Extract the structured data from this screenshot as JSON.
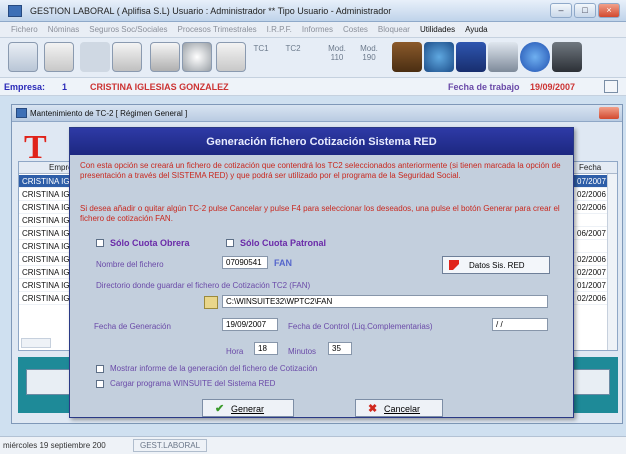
{
  "window": {
    "title": "GESTION LABORAL  ( Aplifisa S.L)  Usuario : Administrador  **  Tipo Usuario - Administrador"
  },
  "menu": [
    "Fichero",
    "Nóminas",
    "Seguros Soc/Sociales",
    "Procesos Trimestrales",
    "I.R.P.F.",
    "Informes",
    "Costes",
    "Bloquear",
    "Utilidades",
    "Ayuda"
  ],
  "toolbar": {
    "tc1_label": "TC1",
    "tc2_label": "TC2",
    "mod110_label": "Mod. 110",
    "mod190_label": "Mod. 190"
  },
  "company": {
    "label": "Empresa:",
    "number": "1",
    "name": "CRISTINA IGLESIAS GONZALEZ",
    "date_label": "Fecha de trabajo",
    "date": "19/09/2007"
  },
  "child": {
    "title": "Mantenimiento de TC-2   [ Régimen General ]",
    "col_empresa": "Empre",
    "col_fecha": "Fecha",
    "rows": [
      {
        "name": "CRISTINA IG",
        "date": "07/2007"
      },
      {
        "name": "CRISTINA IG",
        "date": "02/2006"
      },
      {
        "name": "CRISTINA IG",
        "date": "02/2006"
      },
      {
        "name": "CRISTINA IG",
        "date": ""
      },
      {
        "name": "CRISTINA IG",
        "date": "06/2007"
      },
      {
        "name": "CRISTINA IG",
        "date": ""
      },
      {
        "name": "CRISTINA IG",
        "date": "02/2006"
      },
      {
        "name": "CRISTINA IG",
        "date": "02/2007"
      },
      {
        "name": "CRISTINA IG",
        "date": "01/2007"
      },
      {
        "name": "CRISTINA IG",
        "date": "02/2006"
      }
    ]
  },
  "dialog": {
    "title": "Generación fichero Cotización Sistema RED",
    "info1": "Con esta opción se creará un fichero de cotización que contendrá los TC2 seleccionados anteriormente (si tienen marcada la opción de presentación a través del SISTEMA RED) y que podrá ser utilizado por el programa de la Seguridad Social.",
    "info2": "Si desea añadir o quitar algún TC-2 pulse Cancelar y pulse F4 para seleccionar los deseados, una pulse el botón Generar para crear el fichero de cotización FAN.",
    "solo_cuota_obrera": "Sólo Cuota Obrera",
    "solo_cuota_patronal": "Sólo Cuota Patronal",
    "nombre_fichero_label": "Nombre del fichero",
    "nombre_fichero_value": "07090541",
    "fan_label": "FAN",
    "datos_button": "Datos Sis. RED",
    "directorio_label": "Directorio donde guardar el fichero de Cotización TC2 (FAN)",
    "directorio_value": "C:\\WINSUITE32\\WPTC2\\FAN",
    "fecha_generacion_label": "Fecha de Generación",
    "fecha_generacion_value": "19/09/2007",
    "fecha_control_label": "Fecha de Control (Liq.Complementarias)",
    "fecha_control_value": "/ /",
    "hora_label": "Hora",
    "hora_value": "18",
    "minutos_label": "Minutos",
    "minutos_value": "35",
    "mostrar_informe": "Mostrar informe de la generación del fichero de Cotización",
    "cargar_programa": "Cargar programa WINSUITE del Sistema RED",
    "generar_button": "Generar",
    "cancelar_button": "Cancelar"
  },
  "status": {
    "date": "miércoles 19 septiembre 200",
    "app": "GEST.LABORAL"
  }
}
